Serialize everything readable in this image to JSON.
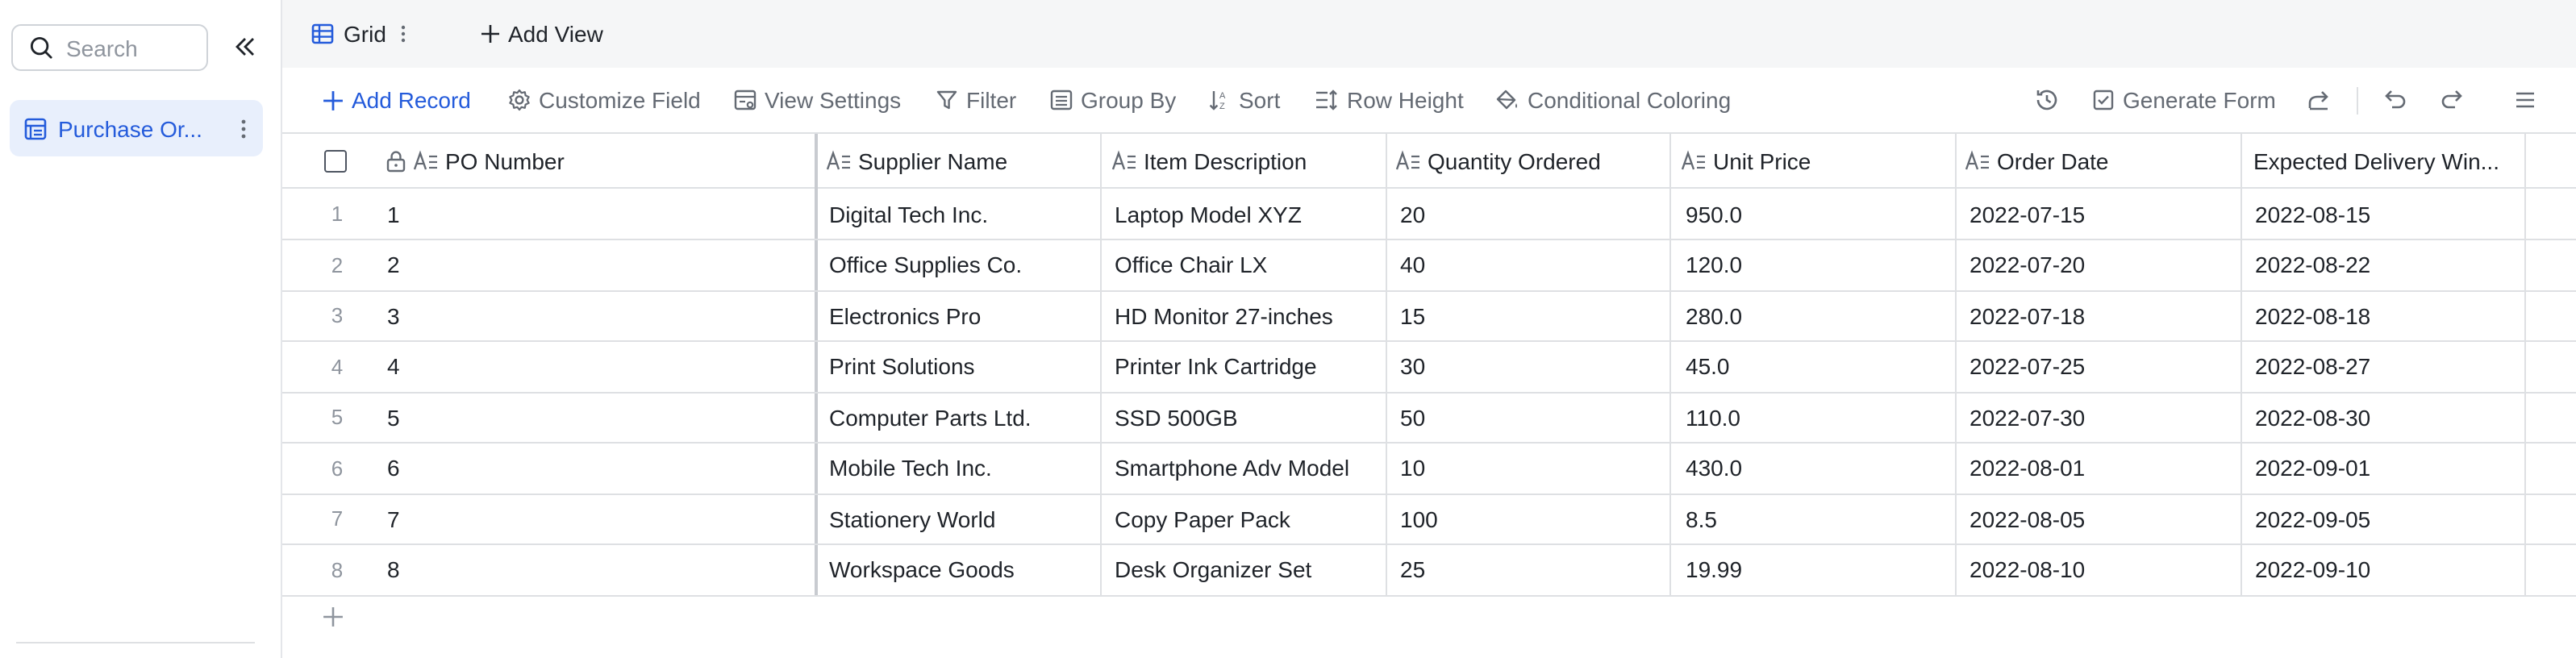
{
  "sidebar": {
    "search_placeholder": "Search",
    "items": [
      {
        "label": "Purchase Or...",
        "icon": "table-icon"
      }
    ]
  },
  "viewbar": {
    "tabs": [
      {
        "label": "Grid",
        "icon": "grid-view-icon"
      }
    ],
    "add_view_label": "Add View"
  },
  "toolbar": {
    "add_record": "Add Record",
    "customize_field": "Customize Field",
    "view_settings": "View Settings",
    "filter": "Filter",
    "group_by": "Group By",
    "sort": "Sort",
    "row_height": "Row Height",
    "conditional_coloring": "Conditional Coloring",
    "generate_form": "Generate Form"
  },
  "grid": {
    "columns": [
      "PO Number",
      "Supplier Name",
      "Item Description",
      "Quantity Ordered",
      "Unit Price",
      "Order Date",
      "Expected Delivery Win..."
    ],
    "rows": [
      {
        "num": "1",
        "cells": [
          "1",
          "Digital Tech Inc.",
          "Laptop Model XYZ",
          "20",
          "950.0",
          "2022-07-15",
          "2022-08-15"
        ]
      },
      {
        "num": "2",
        "cells": [
          "2",
          "Office Supplies Co.",
          "Office Chair LX",
          "40",
          "120.0",
          "2022-07-20",
          "2022-08-22"
        ]
      },
      {
        "num": "3",
        "cells": [
          "3",
          "Electronics Pro",
          "HD Monitor 27-inches",
          "15",
          "280.0",
          "2022-07-18",
          "2022-08-18"
        ]
      },
      {
        "num": "4",
        "cells": [
          "4",
          "Print Solutions",
          "Printer Ink Cartridge",
          "30",
          "45.0",
          "2022-07-25",
          "2022-08-27"
        ]
      },
      {
        "num": "5",
        "cells": [
          "5",
          "Computer Parts Ltd.",
          "SSD 500GB",
          "50",
          "110.0",
          "2022-07-30",
          "2022-08-30"
        ]
      },
      {
        "num": "6",
        "cells": [
          "6",
          "Mobile Tech Inc.",
          "Smartphone Adv Model",
          "10",
          "430.0",
          "2022-08-01",
          "2022-09-01"
        ]
      },
      {
        "num": "7",
        "cells": [
          "7",
          "Stationery World",
          "Copy Paper Pack",
          "100",
          "8.5",
          "2022-08-05",
          "2022-09-05"
        ]
      },
      {
        "num": "8",
        "cells": [
          "8",
          "Workspace Goods",
          "Desk Organizer Set",
          "25",
          "19.99",
          "2022-08-10",
          "2022-09-10"
        ]
      }
    ]
  },
  "colors": {
    "accent": "#245bdb",
    "selected_bg": "#e8effc",
    "muted": "#646a73"
  }
}
